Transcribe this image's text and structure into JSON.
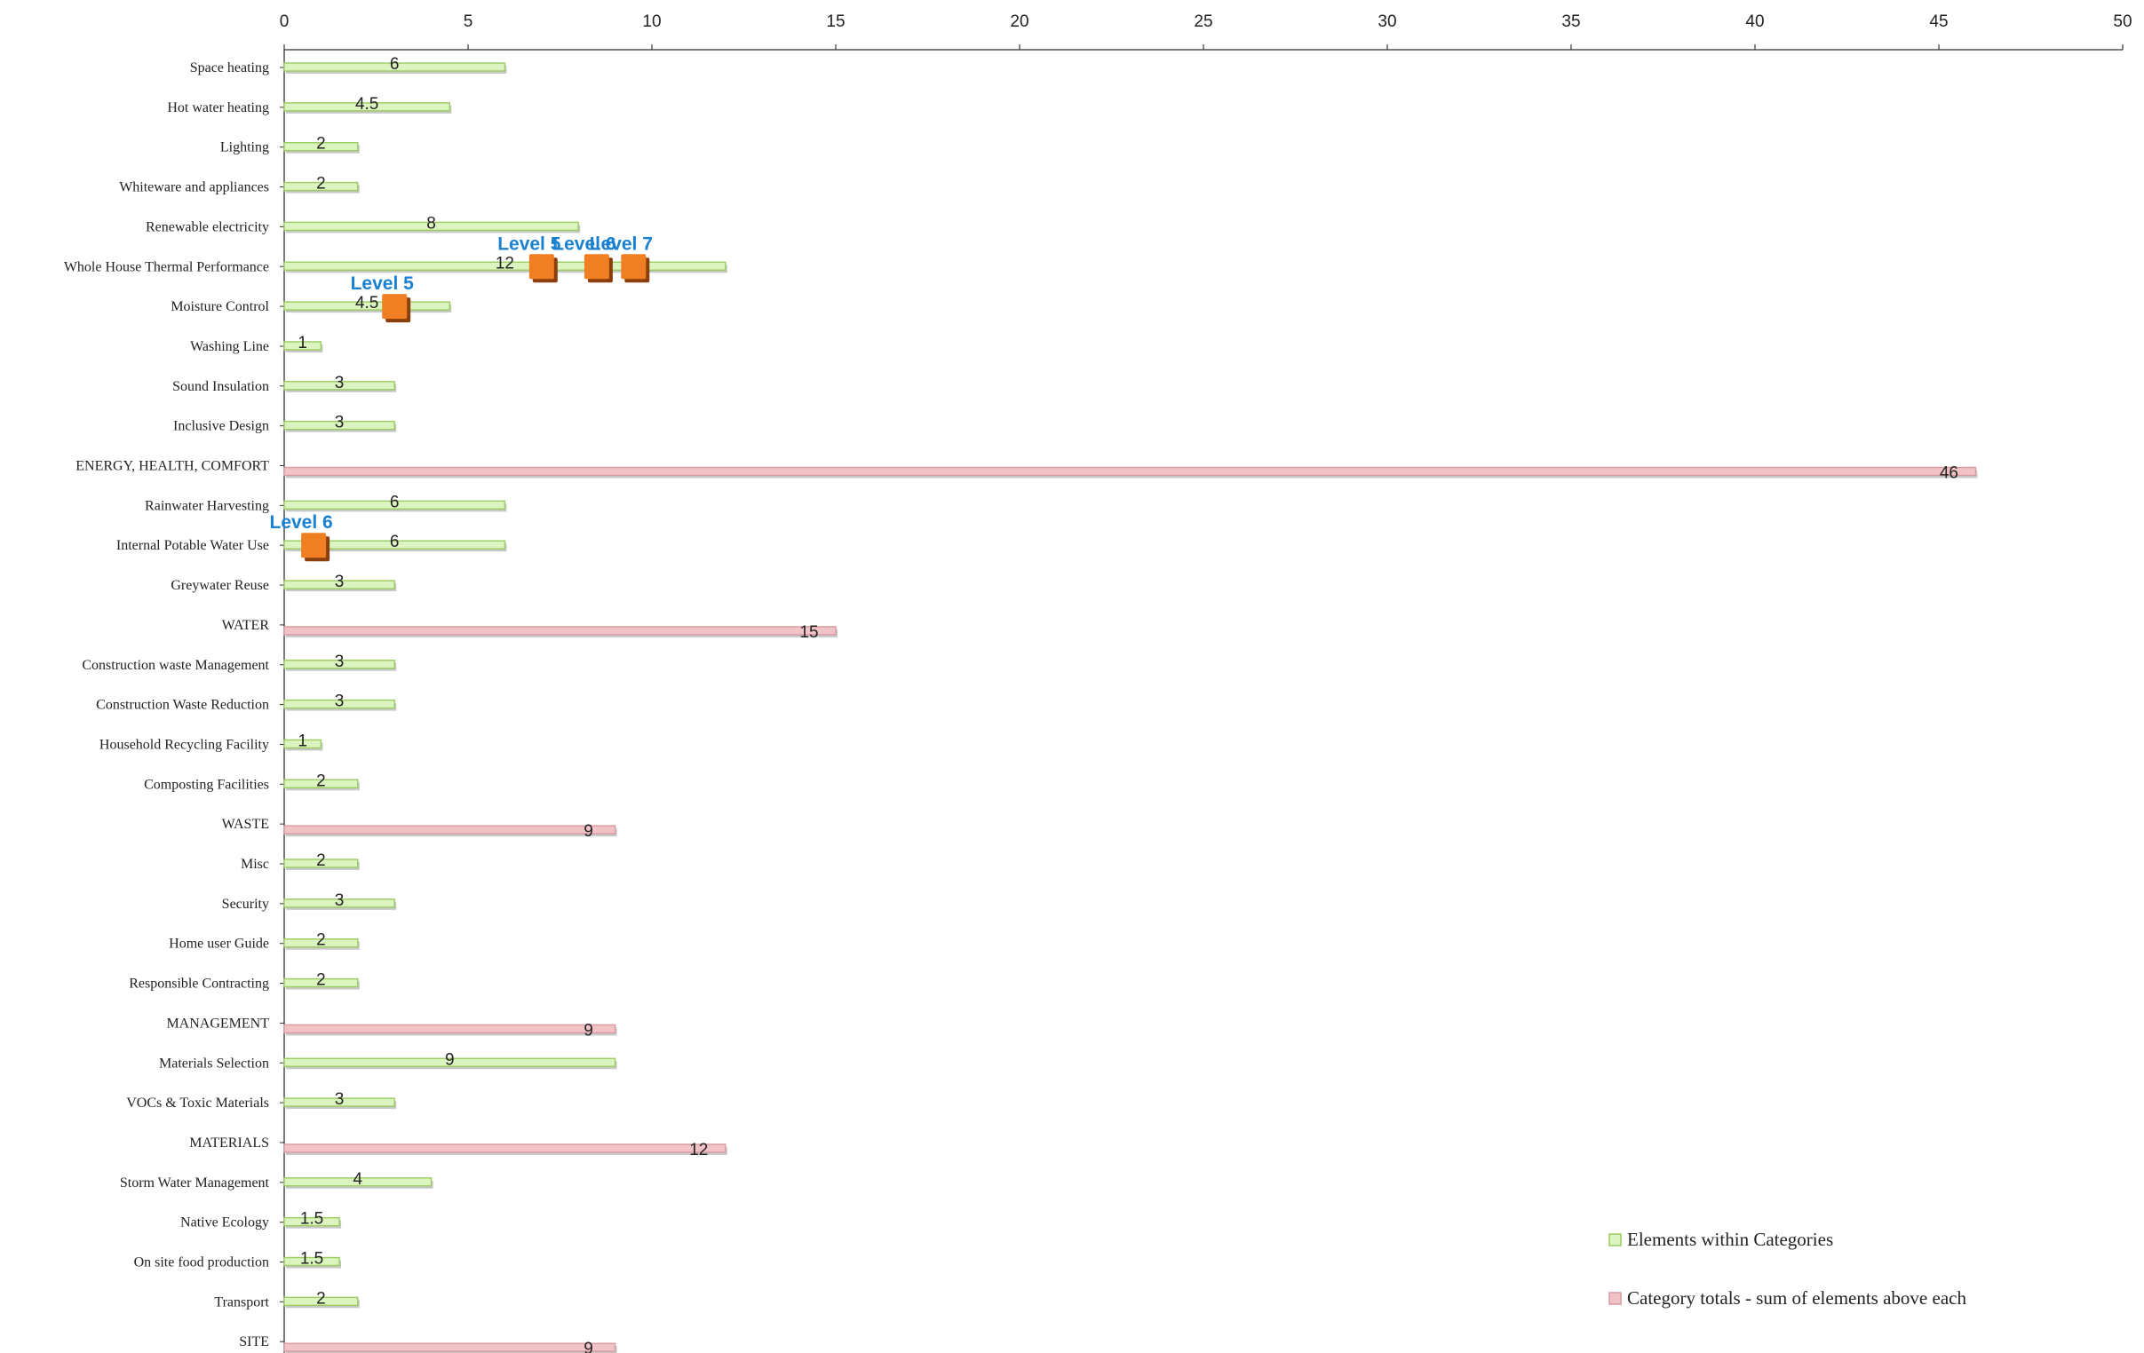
{
  "chart_data": {
    "type": "bar",
    "orientation": "horizontal",
    "title": "",
    "xlabel": "",
    "ylabel": "",
    "xlim": [
      0,
      50
    ],
    "x_ticks": [
      0,
      5,
      10,
      15,
      20,
      25,
      30,
      35,
      40,
      45,
      50
    ],
    "x_axis_position": "top",
    "grid": false,
    "legend_position": "bottom-right",
    "colors": {
      "element_fill": "#dcf5c0",
      "element_stroke": "#9acc60",
      "total_fill": "#f2c3c6",
      "total_stroke": "#d79aa0",
      "marker": "#f07f24",
      "marker_shadow": "#8a3f0c",
      "level_text": "#1a80d0"
    },
    "categories": [
      {
        "label": "Space heating",
        "value": 6,
        "kind": "element"
      },
      {
        "label": "Hot water heating",
        "value": 4.5,
        "kind": "element"
      },
      {
        "label": "Lighting",
        "value": 2,
        "kind": "element"
      },
      {
        "label": "Whiteware and appliances",
        "value": 2,
        "kind": "element"
      },
      {
        "label": "Renewable electricity",
        "value": 8,
        "kind": "element"
      },
      {
        "label": "Whole House Thermal Performance",
        "value": 12,
        "kind": "element"
      },
      {
        "label": "Moisture Control",
        "value": 4.5,
        "kind": "element"
      },
      {
        "label": "Washing Line",
        "value": 1,
        "kind": "element"
      },
      {
        "label": "Sound Insulation",
        "value": 3,
        "kind": "element"
      },
      {
        "label": "Inclusive Design",
        "value": 3,
        "kind": "element"
      },
      {
        "label": "ENERGY, HEALTH, COMFORT",
        "value": 46,
        "kind": "total"
      },
      {
        "label": "Rainwater Harvesting",
        "value": 6,
        "kind": "element"
      },
      {
        "label": "Internal Potable Water Use",
        "value": 6,
        "kind": "element"
      },
      {
        "label": "Greywater Reuse",
        "value": 3,
        "kind": "element"
      },
      {
        "label": "WATER",
        "value": 15,
        "kind": "total"
      },
      {
        "label": "Construction waste Management",
        "value": 3,
        "kind": "element"
      },
      {
        "label": "Construction Waste Reduction",
        "value": 3,
        "kind": "element"
      },
      {
        "label": "Household Recycling Facility",
        "value": 1,
        "kind": "element"
      },
      {
        "label": "Composting Facilities",
        "value": 2,
        "kind": "element"
      },
      {
        "label": "WASTE",
        "value": 9,
        "kind": "total"
      },
      {
        "label": "Misc",
        "value": 2,
        "kind": "element"
      },
      {
        "label": "Security",
        "value": 3,
        "kind": "element"
      },
      {
        "label": "Home user Guide",
        "value": 2,
        "kind": "element"
      },
      {
        "label": "Responsible Contracting",
        "value": 2,
        "kind": "element"
      },
      {
        "label": "MANAGEMENT",
        "value": 9,
        "kind": "total"
      },
      {
        "label": "Materials Selection",
        "value": 9,
        "kind": "element"
      },
      {
        "label": "VOCs & Toxic Materials",
        "value": 3,
        "kind": "element"
      },
      {
        "label": "MATERIALS",
        "value": 12,
        "kind": "total"
      },
      {
        "label": "Storm Water Management",
        "value": 4,
        "kind": "element"
      },
      {
        "label": "Native Ecology",
        "value": 1.5,
        "kind": "element"
      },
      {
        "label": "On site food production",
        "value": 1.5,
        "kind": "element"
      },
      {
        "label": "Transport",
        "value": 2,
        "kind": "element"
      },
      {
        "label": "SITE",
        "value": 9,
        "kind": "total"
      }
    ],
    "annotations": [
      {
        "category": "Whole House Thermal Performance",
        "x": 7,
        "label": "Level 5"
      },
      {
        "category": "Whole House Thermal Performance",
        "x": 8.5,
        "label": "Level 6"
      },
      {
        "category": "Whole House Thermal Performance",
        "x": 9.5,
        "label": "Level 7"
      },
      {
        "category": "Moisture Control",
        "x": 3,
        "label": "Level 5"
      },
      {
        "category": "Internal Potable Water Use",
        "x": 0.8,
        "label": "Level 6"
      }
    ],
    "legend": [
      {
        "label": "Elements within Categories",
        "kind": "element"
      },
      {
        "label": "Category totals - sum of elements above each",
        "kind": "total"
      }
    ]
  }
}
